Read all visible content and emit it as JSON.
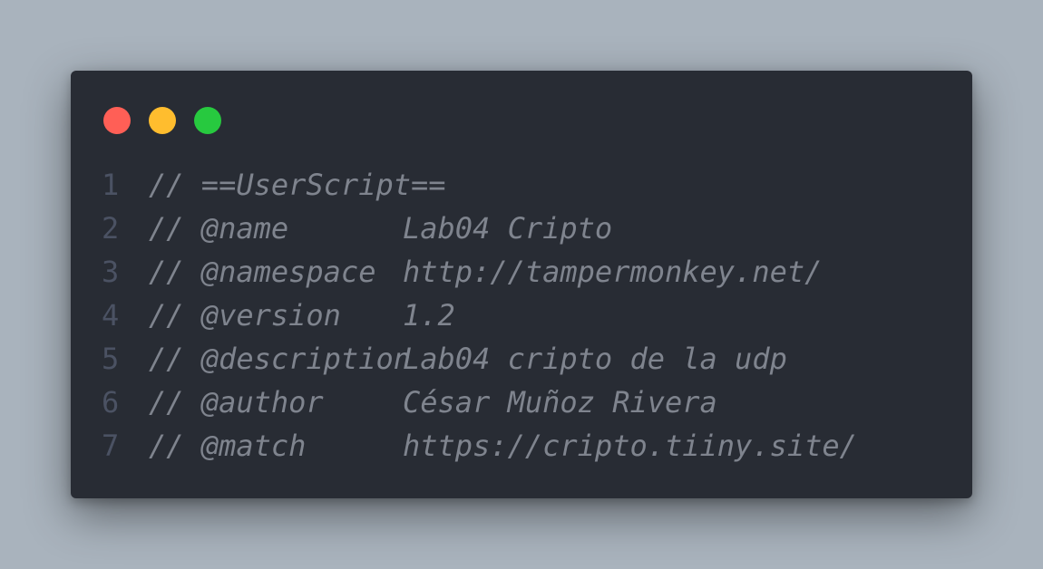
{
  "window_controls": [
    {
      "name": "close-button",
      "color": "#ff5f56"
    },
    {
      "name": "minimize-button",
      "color": "#ffbd2e"
    },
    {
      "name": "maximize-button",
      "color": "#27c93f"
    }
  ],
  "code": {
    "lines": [
      {
        "number": "1",
        "text": "// ==UserScript=="
      },
      {
        "number": "2",
        "key": "// @name",
        "value": "Lab04 Cripto"
      },
      {
        "number": "3",
        "key": "// @namespace",
        "value": "http://tampermonkey.net/"
      },
      {
        "number": "4",
        "key": "// @version",
        "value": "1.2"
      },
      {
        "number": "5",
        "key": "// @description",
        "value": "Lab04 cripto de la udp"
      },
      {
        "number": "6",
        "key": "// @author",
        "value": "César Muñoz Rivera"
      },
      {
        "number": "7",
        "key": "// @match",
        "value": "https://cripto.tiiny.site/"
      }
    ]
  }
}
